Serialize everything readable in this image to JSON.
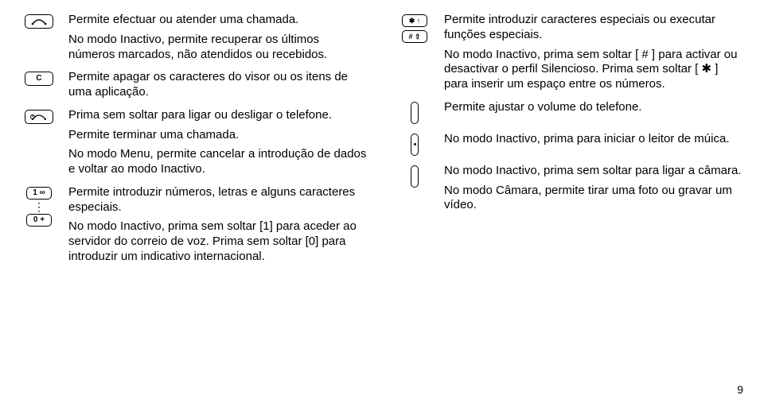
{
  "pageNumber": "9",
  "leftColumn": {
    "row1": {
      "p1": "Permite efectuar ou atender uma chamada.",
      "p2": "No modo Inactivo, permite recuperar os últimos números marcados, não atendidos ou recebidos."
    },
    "row2": {
      "p1": "Permite apagar os caracteres do visor ou os itens de uma aplicação."
    },
    "row3": {
      "p1": "Prima sem soltar para ligar ou desligar o telefone.",
      "p2": "Permite terminar uma chamada.",
      "p3": "No modo Menu, permite cancelar a introdução de dados e voltar ao modo Inactivo."
    },
    "row4": {
      "p1": "Permite introduzir números, letras e alguns caracteres especiais.",
      "p2": "No modo Inactivo, prima sem soltar [1] para aceder ao servidor do correio de voz. Prima sem soltar [0] para introduzir um indicativo internacional."
    }
  },
  "rightColumn": {
    "row1": {
      "p1": "Permite introduzir caracteres especiais ou executar funções especiais.",
      "p2": "No modo Inactivo, prima sem soltar [ # ] para activar ou desactivar o perfil Silencioso. Prima sem soltar [ ✱ ] para inserir um espaço entre os números."
    },
    "row2": {
      "p1": "Permite ajustar o volume do telefone."
    },
    "row3": {
      "p1": "No modo Inactivo, prima para iniciar o leitor de múica."
    },
    "row4": {
      "p1": "No modo Inactivo, prima sem soltar para ligar a câmara.",
      "p2": "No modo Câmara, permite tirar uma foto ou gravar um vídeo."
    }
  },
  "keys": {
    "call": "⌒",
    "clear": "C",
    "power": "⏻",
    "one": "1 ∞",
    "zero": "0 +",
    "star": "✱ ↑",
    "hash": "# ⇧"
  }
}
